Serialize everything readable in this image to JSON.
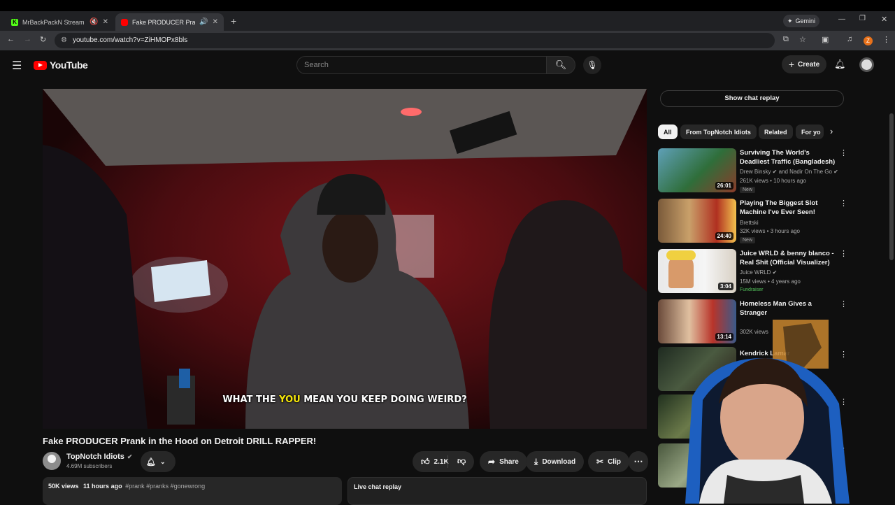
{
  "browser": {
    "tabs": [
      {
        "title": "MrBackPackN Stream - Wa",
        "favicon_color": "#53fc18"
      },
      {
        "title": "Fake PRODUCER Prank in th",
        "favicon_color": "#ff0000"
      }
    ],
    "new_tab": "+",
    "gemini_label": "Gemini",
    "url": "youtube.com/watch?v=ZiHMOPx8bls",
    "profile_initial": "Z"
  },
  "youtube": {
    "logo_text": "YouTube",
    "search_placeholder": "Search",
    "create_label": "Create",
    "video": {
      "caption_pre": "WHAT THE ",
      "caption_highlight": "YOU",
      "caption_post": " MEAN YOU KEEP DOING WEIRD?",
      "title": "Fake PRODUCER Prank in the Hood on Detroit DRILL RAPPER!",
      "channel": "TopNotch Idiots",
      "subscribers": "4.69M subscribers",
      "likes": "2.1K",
      "share_label": "Share",
      "download_label": "Download",
      "clip_label": "Clip",
      "views": "50K views",
      "posted": "11 hours ago",
      "hashtags": "#prank #pranks #gonewrong",
      "live_chat_label": "Live chat replay"
    },
    "sidebar": {
      "show_chat_replay": "Show chat replay",
      "chips": [
        "All",
        "From TopNotch Idiots",
        "Related",
        "For yo"
      ],
      "recommendations": [
        {
          "title": "Surviving The World's Deadliest Traffic (Bangladesh)",
          "channel": "Drew Binsky",
          "channel_extra": " and Nadir On The Go",
          "meta": "261K views • 10 hours ago",
          "badge": "New",
          "duration": "26:01"
        },
        {
          "title": "Playing The Biggest Slot Machine I've Ever Seen!",
          "channel": "Brettski",
          "channel_extra": "",
          "meta": "32K views • 3 hours ago",
          "badge": "New",
          "duration": "24:40"
        },
        {
          "title": "Juice WRLD & benny blanco - Real Shit (Official Visualizer)",
          "channel": "Juice WRLD",
          "channel_extra": "",
          "meta": "15M views • 4 years ago",
          "badge": "Fundraiser",
          "duration": "3:04"
        },
        {
          "title": "Homeless Man Gives a Stranger",
          "channel": "",
          "channel_extra": "",
          "meta": "302K views",
          "badge": "",
          "duration": "13:14"
        },
        {
          "title": "Kendrick Lamar",
          "channel": "",
          "channel_extra": "",
          "meta": "",
          "badge": "",
          "duration": ""
        }
      ]
    }
  }
}
